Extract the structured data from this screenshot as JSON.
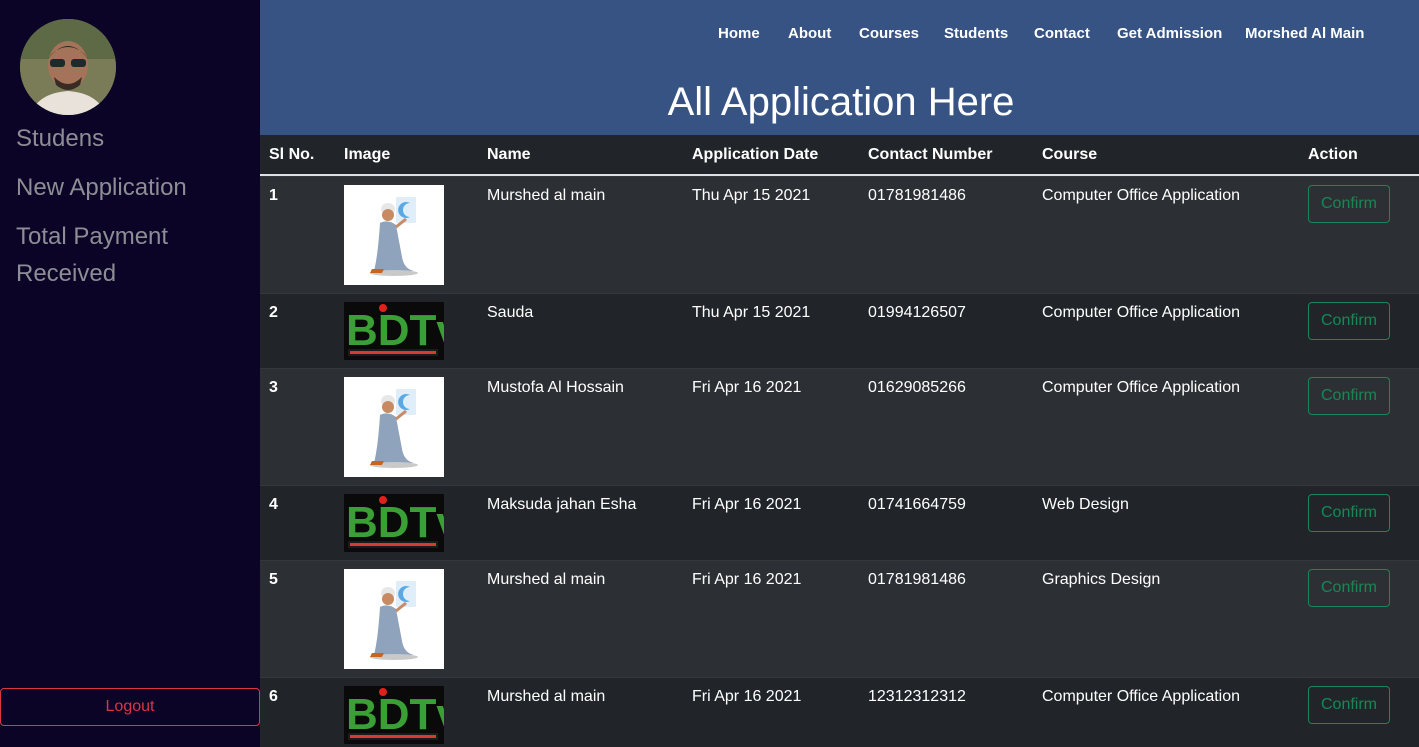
{
  "sidebar": {
    "items": [
      {
        "label": "Studens"
      },
      {
        "label": "New Application"
      },
      {
        "label": "Total Payment Received"
      }
    ],
    "logout_label": "Logout"
  },
  "nav": {
    "items": [
      {
        "label": "Home"
      },
      {
        "label": "About"
      },
      {
        "label": "Courses"
      },
      {
        "label": "Students"
      },
      {
        "label": "Contact"
      },
      {
        "label": "Get Admission"
      },
      {
        "label": "Morshed Al Main"
      }
    ]
  },
  "page": {
    "title": "All Application Here"
  },
  "table": {
    "headers": [
      "Sl No.",
      "Image",
      "Name",
      "Application Date",
      "Contact Number",
      "Course",
      "Action"
    ],
    "rows": [
      {
        "sl": "1",
        "image": "prayer-illustration",
        "name": "Murshed al main",
        "date": "Thu Apr 15 2021",
        "contact": "01781981486",
        "course": "Computer Office Application",
        "action": "Confirm"
      },
      {
        "sl": "2",
        "image": "bdtv-logo",
        "name": "Sauda",
        "date": "Thu Apr 15 2021",
        "contact": "01994126507",
        "course": "Computer Office Application",
        "action": "Confirm"
      },
      {
        "sl": "3",
        "image": "prayer-illustration",
        "name": "Mustofa Al Hossain",
        "date": "Fri Apr 16 2021",
        "contact": "01629085266",
        "course": "Computer Office Application",
        "action": "Confirm"
      },
      {
        "sl": "4",
        "image": "bdtv-logo",
        "name": "Maksuda jahan Esha",
        "date": "Fri Apr 16 2021",
        "contact": "01741664759",
        "course": "Web Design",
        "action": "Confirm"
      },
      {
        "sl": "5",
        "image": "prayer-illustration",
        "name": "Murshed al main",
        "date": "Fri Apr 16 2021",
        "contact": "01781981486",
        "course": "Graphics Design",
        "action": "Confirm"
      },
      {
        "sl": "6",
        "image": "bdtv-logo",
        "name": "Murshed al main",
        "date": "Fri Apr 16 2021",
        "contact": "12312312312",
        "course": "Computer Office Application",
        "action": "Confirm"
      }
    ]
  },
  "logo_text": {
    "bdtv": "BDTv"
  },
  "colors": {
    "header": "#375383",
    "sidebar": "#0b0426",
    "confirm": "#198754",
    "logout": "#dc3545"
  }
}
